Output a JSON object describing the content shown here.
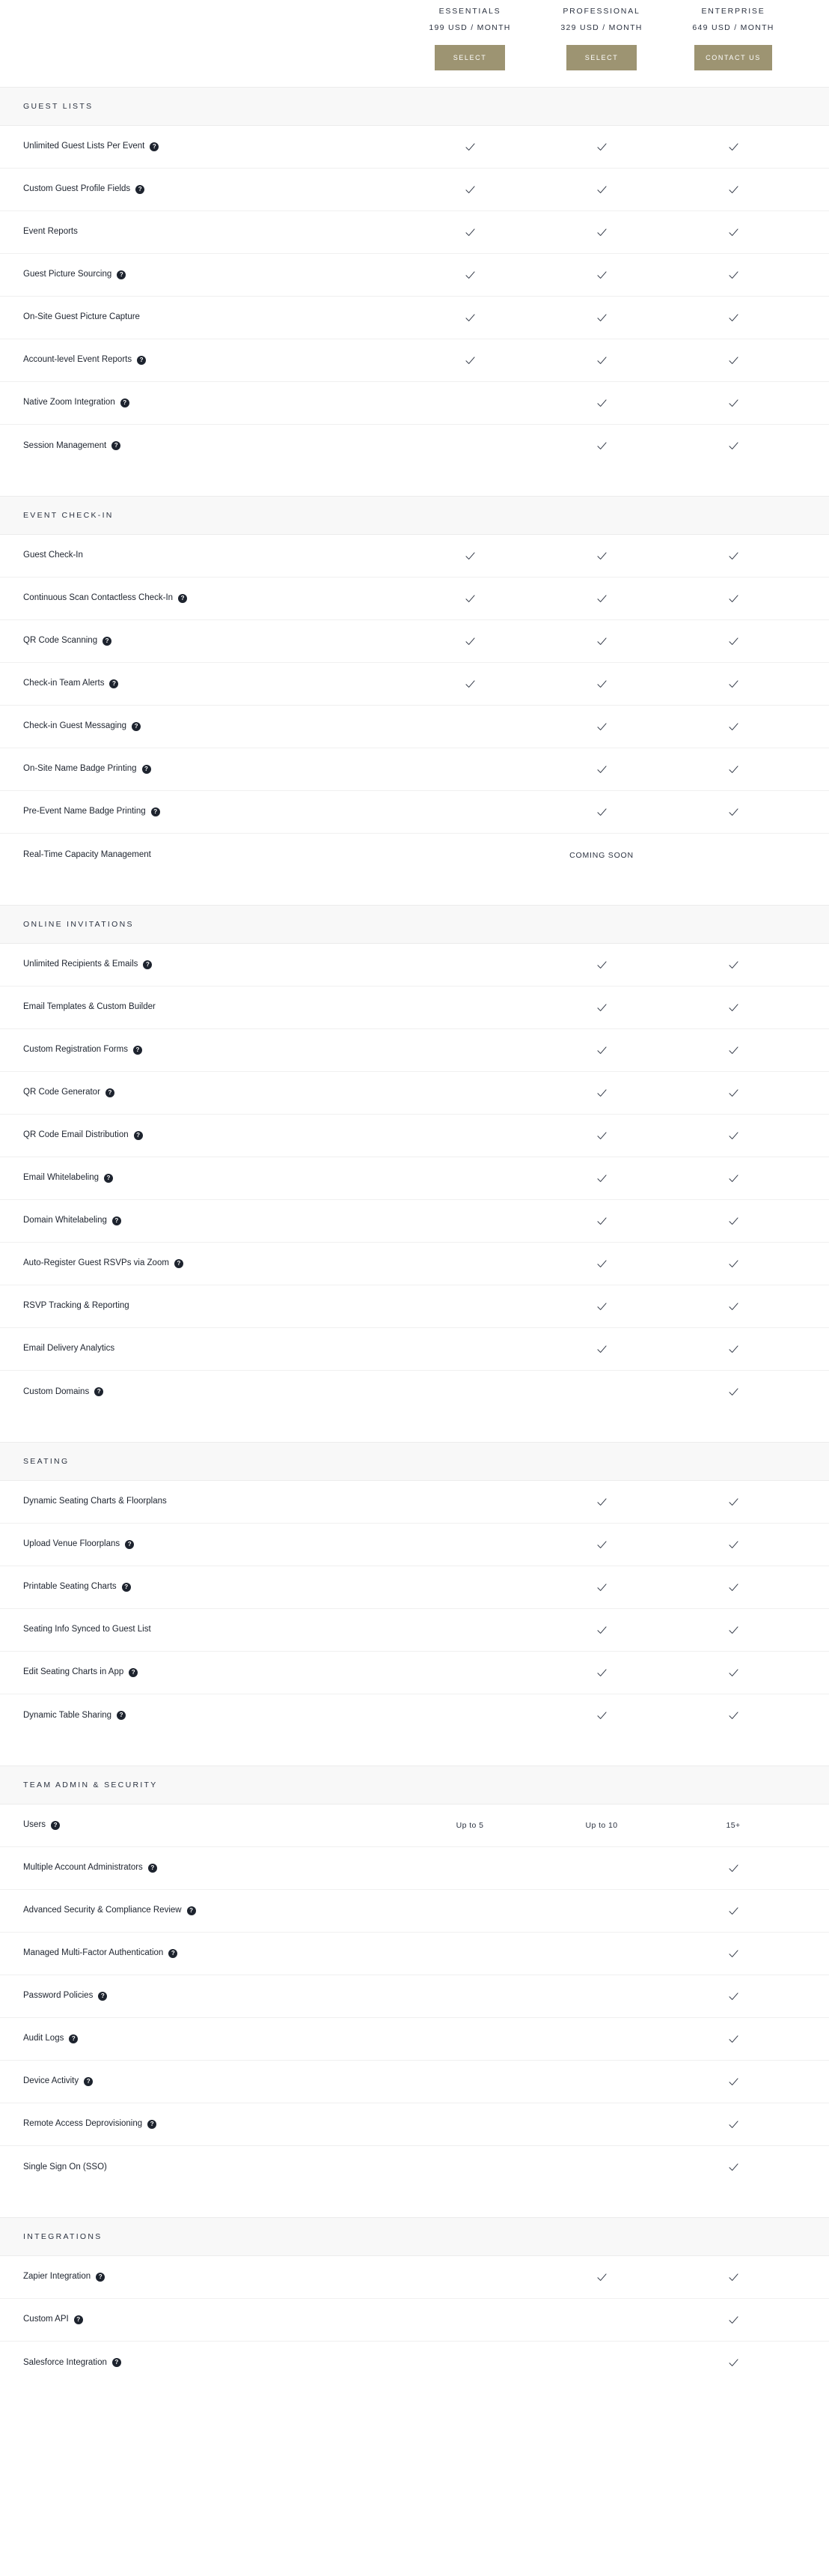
{
  "plans": [
    {
      "name": "ESSENTIALS",
      "price": "199 USD / MONTH",
      "cta": "SELECT"
    },
    {
      "name": "PROFESSIONAL",
      "price": "329 USD / MONTH",
      "cta": "SELECT"
    },
    {
      "name": "ENTERPRISE",
      "price": "649 USD / MONTH",
      "cta": "CONTACT US"
    }
  ],
  "icons": {
    "help": "?"
  },
  "colors": {
    "cta_background": "#9d9472",
    "section_band": "#f8f8f8",
    "check": "#2b3240",
    "help_badge": "#1d232e"
  },
  "sections": [
    {
      "title": "GUEST LISTS",
      "rows": [
        {
          "label": "Unlimited Guest Lists Per Event",
          "help": true,
          "cells": [
            "check",
            "check",
            "check"
          ]
        },
        {
          "label": "Custom Guest Profile Fields",
          "help": true,
          "cells": [
            "check",
            "check",
            "check"
          ]
        },
        {
          "label": "Event Reports",
          "help": false,
          "cells": [
            "check",
            "check",
            "check"
          ]
        },
        {
          "label": "Guest Picture Sourcing",
          "help": true,
          "cells": [
            "check",
            "check",
            "check"
          ]
        },
        {
          "label": "On-Site Guest Picture Capture",
          "help": false,
          "cells": [
            "check",
            "check",
            "check"
          ]
        },
        {
          "label": "Account-level Event Reports",
          "help": true,
          "cells": [
            "check",
            "check",
            "check"
          ]
        },
        {
          "label": "Native Zoom Integration",
          "help": true,
          "cells": [
            "",
            "check",
            "check"
          ]
        },
        {
          "label": "Session Management",
          "help": true,
          "cells": [
            "",
            "check",
            "check"
          ]
        }
      ]
    },
    {
      "title": "EVENT CHECK-IN",
      "rows": [
        {
          "label": "Guest Check-In",
          "help": false,
          "cells": [
            "check",
            "check",
            "check"
          ]
        },
        {
          "label": "Continuous Scan Contactless Check-In",
          "help": true,
          "cells": [
            "check",
            "check",
            "check"
          ]
        },
        {
          "label": "QR Code Scanning",
          "help": true,
          "cells": [
            "check",
            "check",
            "check"
          ]
        },
        {
          "label": "Check-in Team Alerts",
          "help": true,
          "cells": [
            "check",
            "check",
            "check"
          ]
        },
        {
          "label": "Check-in Guest Messaging",
          "help": true,
          "cells": [
            "",
            "check",
            "check"
          ]
        },
        {
          "label": "On-Site Name Badge Printing",
          "help": true,
          "cells": [
            "",
            "check",
            "check"
          ]
        },
        {
          "label": "Pre-Event Name Badge Printing",
          "help": true,
          "cells": [
            "",
            "check",
            "check"
          ]
        },
        {
          "label": "Real-Time Capacity Management",
          "help": false,
          "cells": [
            "",
            "COMING SOON",
            ""
          ]
        }
      ]
    },
    {
      "title": "ONLINE INVITATIONS",
      "rows": [
        {
          "label": "Unlimited Recipients & Emails",
          "help": true,
          "cells": [
            "",
            "check",
            "check"
          ]
        },
        {
          "label": "Email Templates & Custom Builder",
          "help": false,
          "cells": [
            "",
            "check",
            "check"
          ]
        },
        {
          "label": "Custom Registration Forms",
          "help": true,
          "cells": [
            "",
            "check",
            "check"
          ]
        },
        {
          "label": "QR Code Generator",
          "help": true,
          "cells": [
            "",
            "check",
            "check"
          ]
        },
        {
          "label": "QR Code Email Distribution",
          "help": true,
          "cells": [
            "",
            "check",
            "check"
          ]
        },
        {
          "label": "Email Whitelabeling",
          "help": true,
          "cells": [
            "",
            "check",
            "check"
          ]
        },
        {
          "label": "Domain Whitelabeling",
          "help": true,
          "cells": [
            "",
            "check",
            "check"
          ]
        },
        {
          "label": "Auto-Register Guest RSVPs via Zoom",
          "help": true,
          "cells": [
            "",
            "check",
            "check"
          ]
        },
        {
          "label": "RSVP Tracking & Reporting",
          "help": false,
          "cells": [
            "",
            "check",
            "check"
          ]
        },
        {
          "label": "Email Delivery Analytics",
          "help": false,
          "cells": [
            "",
            "check",
            "check"
          ]
        },
        {
          "label": "Custom Domains",
          "help": true,
          "cells": [
            "",
            "",
            "check"
          ]
        }
      ]
    },
    {
      "title": "SEATING",
      "rows": [
        {
          "label": "Dynamic Seating Charts & Floorplans",
          "help": false,
          "cells": [
            "",
            "check",
            "check"
          ]
        },
        {
          "label": "Upload Venue Floorplans",
          "help": true,
          "cells": [
            "",
            "check",
            "check"
          ]
        },
        {
          "label": "Printable Seating Charts",
          "help": true,
          "cells": [
            "",
            "check",
            "check"
          ]
        },
        {
          "label": "Seating Info Synced to Guest List",
          "help": false,
          "cells": [
            "",
            "check",
            "check"
          ]
        },
        {
          "label": "Edit Seating Charts in App",
          "help": true,
          "cells": [
            "",
            "check",
            "check"
          ]
        },
        {
          "label": "Dynamic Table Sharing",
          "help": true,
          "cells": [
            "",
            "check",
            "check"
          ]
        }
      ]
    },
    {
      "title": "TEAM ADMIN & SECURITY",
      "rows": [
        {
          "label": "Users",
          "help": true,
          "cells": [
            "Up to 5",
            "Up to 10",
            "15+"
          ]
        },
        {
          "label": "Multiple Account Administrators",
          "help": true,
          "cells": [
            "",
            "",
            "check"
          ]
        },
        {
          "label": "Advanced Security & Compliance Review",
          "help": true,
          "cells": [
            "",
            "",
            "check"
          ]
        },
        {
          "label": "Managed Multi-Factor Authentication",
          "help": true,
          "cells": [
            "",
            "",
            "check"
          ]
        },
        {
          "label": "Password Policies",
          "help": true,
          "cells": [
            "",
            "",
            "check"
          ]
        },
        {
          "label": "Audit Logs",
          "help": true,
          "cells": [
            "",
            "",
            "check"
          ]
        },
        {
          "label": "Device Activity",
          "help": true,
          "cells": [
            "",
            "",
            "check"
          ]
        },
        {
          "label": "Remote Access Deprovisioning",
          "help": true,
          "cells": [
            "",
            "",
            "check"
          ]
        },
        {
          "label": "Single Sign On (SSO)",
          "help": false,
          "cells": [
            "",
            "",
            "check"
          ]
        }
      ]
    },
    {
      "title": "INTEGRATIONS",
      "rows": [
        {
          "label": "Zapier Integration",
          "help": true,
          "cells": [
            "",
            "check",
            "check"
          ]
        },
        {
          "label": "Custom API",
          "help": true,
          "cells": [
            "",
            "",
            "check"
          ]
        },
        {
          "label": "Salesforce Integration",
          "help": true,
          "cells": [
            "",
            "",
            "check"
          ]
        }
      ]
    }
  ]
}
